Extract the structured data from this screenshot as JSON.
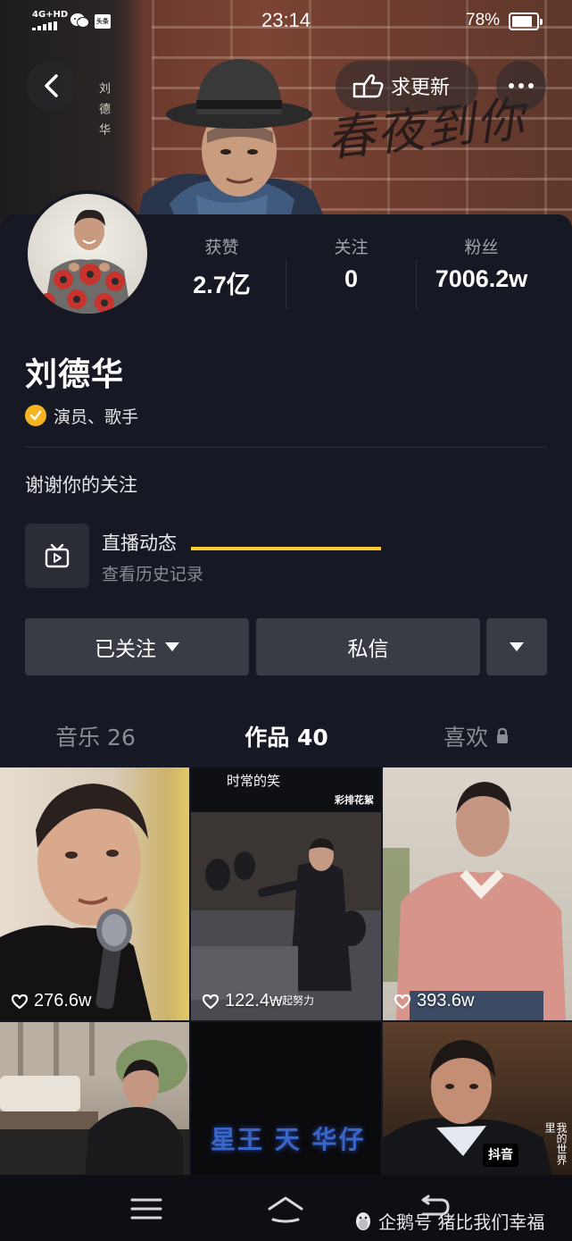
{
  "status_bar": {
    "network": "4G+HD",
    "time": "23:14",
    "battery": "78%",
    "battery_level": 0.78,
    "toutiao_badge": "头条"
  },
  "cover": {
    "vertical_text": "刘德华",
    "script_text": "春夜到你"
  },
  "header": {
    "request_update_label": "求更新"
  },
  "stats": [
    {
      "label": "获赞",
      "value": "2.7亿"
    },
    {
      "label": "关注",
      "value": "0"
    },
    {
      "label": "粉丝",
      "value": "7006.2w"
    }
  ],
  "profile": {
    "name": "刘德华",
    "verification": "演员、歌手",
    "bio": "谢谢你的关注"
  },
  "live": {
    "title": "直播动态",
    "subtitle": "查看历史记录"
  },
  "actions": {
    "followed_label": "已关注",
    "message_label": "私信"
  },
  "tabs": [
    {
      "label": "音乐 26",
      "active": false
    },
    {
      "label": "作品 40",
      "active": true
    },
    {
      "label": "喜欢",
      "active": false,
      "locked": true
    }
  ],
  "videos": [
    {
      "likes": "276.6w",
      "caption": ""
    },
    {
      "likes": "122.4w",
      "caption": "彩排花絮",
      "overlay_top": "时常的笑",
      "overlay_mid": "一起努力"
    },
    {
      "likes": "393.6w",
      "caption": ""
    },
    {
      "likes": "",
      "caption": ""
    },
    {
      "likes": "",
      "caption": "",
      "overlay": "星王 天 华仔"
    },
    {
      "likes": "",
      "caption": "",
      "overlay": "我的世界里",
      "logo": "抖音"
    }
  ],
  "watermark": "企鹅号 猪比我们幸福",
  "colors": {
    "background": "#161823",
    "button": "#393b45",
    "tab_underline": "#fecc2f",
    "verify_badge": "#f7b320"
  }
}
